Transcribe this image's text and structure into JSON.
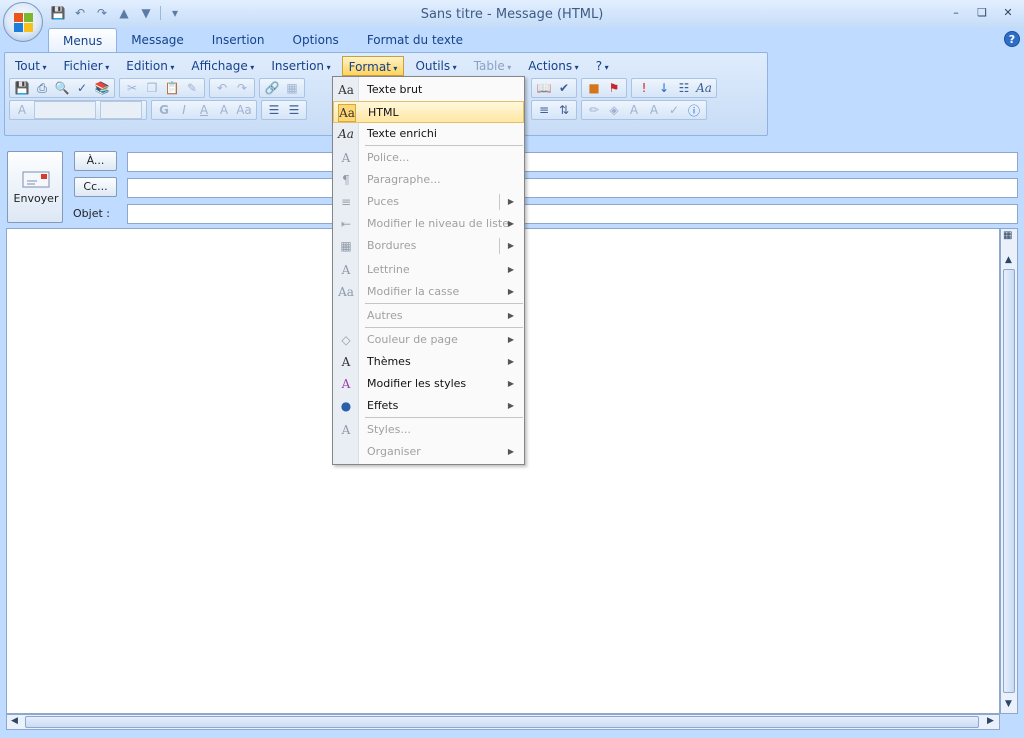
{
  "window": {
    "title": "Sans titre - Message (HTML)",
    "minimize": "–",
    "maximize": "❏",
    "close": "✕"
  },
  "tabs": [
    "Menus",
    "Message",
    "Insertion",
    "Options",
    "Format du texte"
  ],
  "help": "?",
  "menubar": [
    {
      "label": "Tout",
      "state": "normal"
    },
    {
      "label": "Fichier",
      "state": "normal"
    },
    {
      "label": "Edition",
      "state": "normal"
    },
    {
      "label": "Affichage",
      "state": "normal"
    },
    {
      "label": "Insertion",
      "state": "normal"
    },
    {
      "label": "Format",
      "state": "active"
    },
    {
      "label": "Outils",
      "state": "normal"
    },
    {
      "label": "Table",
      "state": "disabled"
    },
    {
      "label": "Actions",
      "state": "normal"
    },
    {
      "label": "?",
      "state": "normal"
    }
  ],
  "format_buttons": {
    "bold": "G",
    "italic": "I",
    "underline": "A",
    "grow": "A",
    "case": "Aa"
  },
  "compose": {
    "send_label": "Envoyer",
    "to_button": "À...",
    "cc_button": "Cc...",
    "subject_label": "Objet :",
    "to_value": "",
    "cc_value": "",
    "subject_value": ""
  },
  "format_menu": [
    {
      "icon": "Aa",
      "icon_name": "plain-text-icon",
      "label": "Texte brut",
      "state": "enabled",
      "submenu": false
    },
    {
      "icon": "Aa",
      "icon_name": "html-format-icon",
      "label": "HTML",
      "state": "highlighted",
      "submenu": false
    },
    {
      "icon": "Aa",
      "icon_name": "rich-text-icon",
      "label": "Texte enrichi",
      "state": "enabled",
      "submenu": false
    },
    {
      "icon": "A",
      "icon_name": "font-icon",
      "label": "Police...",
      "state": "disabled",
      "submenu": false
    },
    {
      "icon": "¶",
      "icon_name": "paragraph-icon",
      "label": "Paragraphe...",
      "state": "disabled",
      "submenu": false
    },
    {
      "icon": "≡",
      "icon_name": "bullets-icon",
      "label": "Puces",
      "state": "disabled",
      "submenu": true,
      "split": true
    },
    {
      "icon": "⇤",
      "icon_name": "list-level-icon",
      "label": "Modifier le niveau de liste",
      "state": "disabled",
      "submenu": true
    },
    {
      "icon": "▦",
      "icon_name": "borders-icon",
      "label": "Bordures",
      "state": "disabled",
      "submenu": true,
      "split": true
    },
    {
      "icon": "A",
      "icon_name": "dropcap-icon",
      "label": "Lettrine",
      "state": "disabled",
      "submenu": true
    },
    {
      "icon": "Aa",
      "icon_name": "change-case-icon",
      "label": "Modifier la casse",
      "state": "disabled",
      "submenu": true
    },
    {
      "icon": "",
      "icon_name": "",
      "label": "Autres",
      "state": "disabled",
      "submenu": true
    },
    {
      "icon": "◇",
      "icon_name": "page-color-icon",
      "label": "Couleur de page",
      "state": "disabled",
      "submenu": true
    },
    {
      "icon": "A",
      "icon_name": "themes-icon",
      "label": "Thèmes",
      "state": "enabled",
      "submenu": true
    },
    {
      "icon": "A",
      "icon_name": "change-styles-icon",
      "label": "Modifier les styles",
      "state": "enabled",
      "submenu": true
    },
    {
      "icon": "●",
      "icon_name": "effects-icon",
      "label": "Effets",
      "state": "enabled",
      "submenu": true
    },
    {
      "icon": "A",
      "icon_name": "styles-icon",
      "label": "Styles...",
      "state": "disabled",
      "submenu": false
    },
    {
      "icon": "",
      "icon_name": "",
      "label": "Organiser",
      "state": "disabled",
      "submenu": true
    }
  ],
  "colors": {
    "ribbon": "#c7dcf6",
    "accent": "#15428b",
    "highlight": "#ffe7a2"
  }
}
